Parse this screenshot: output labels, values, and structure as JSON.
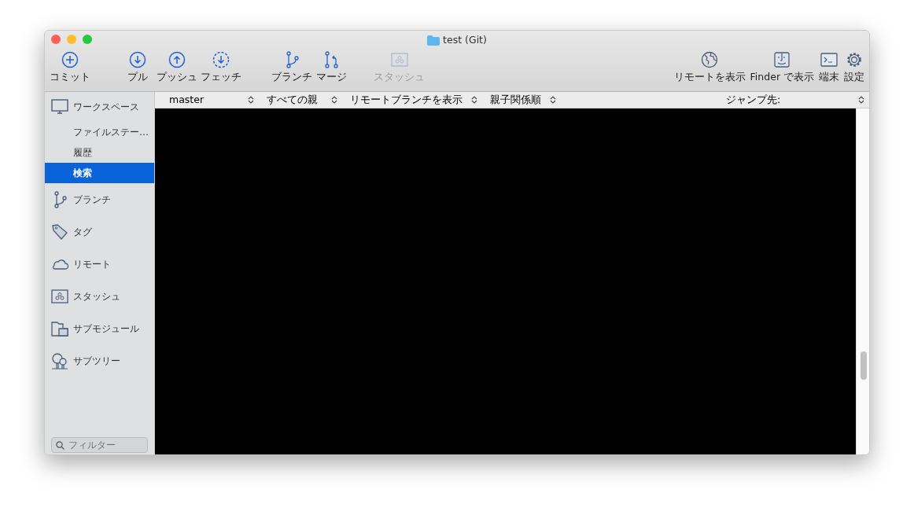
{
  "window": {
    "title": "test (Git)"
  },
  "toolbar": {
    "left": [
      {
        "label": "コミット",
        "disabled": false
      },
      {
        "label": "プル",
        "disabled": false
      },
      {
        "label": "プッシュ",
        "disabled": false
      },
      {
        "label": "フェッチ",
        "disabled": false
      },
      {
        "label": "ブランチ",
        "disabled": false
      },
      {
        "label": "マージ",
        "disabled": false
      },
      {
        "label": "スタッシュ",
        "disabled": true
      }
    ],
    "right": [
      {
        "label": "リモートを表示"
      },
      {
        "label": "Finder で表示"
      },
      {
        "label": "端末"
      },
      {
        "label": "設定"
      }
    ]
  },
  "sidebar": {
    "sections": [
      {
        "label": "ワークスペース",
        "children": [
          {
            "label": "ファイルステー…",
            "selected": false
          },
          {
            "label": "履歴",
            "selected": false
          },
          {
            "label": "検索",
            "selected": true
          }
        ]
      },
      {
        "label": "ブランチ"
      },
      {
        "label": "タグ"
      },
      {
        "label": "リモート"
      },
      {
        "label": "スタッシュ"
      },
      {
        "label": "サブモジュール"
      },
      {
        "label": "サブツリー"
      }
    ],
    "filter": {
      "placeholder": "フィルター"
    }
  },
  "history_bar": {
    "selectors": [
      "master",
      "すべての親",
      "リモートブランチを表示",
      "親子関係順"
    ],
    "jump": "ジャンプ先:"
  }
}
